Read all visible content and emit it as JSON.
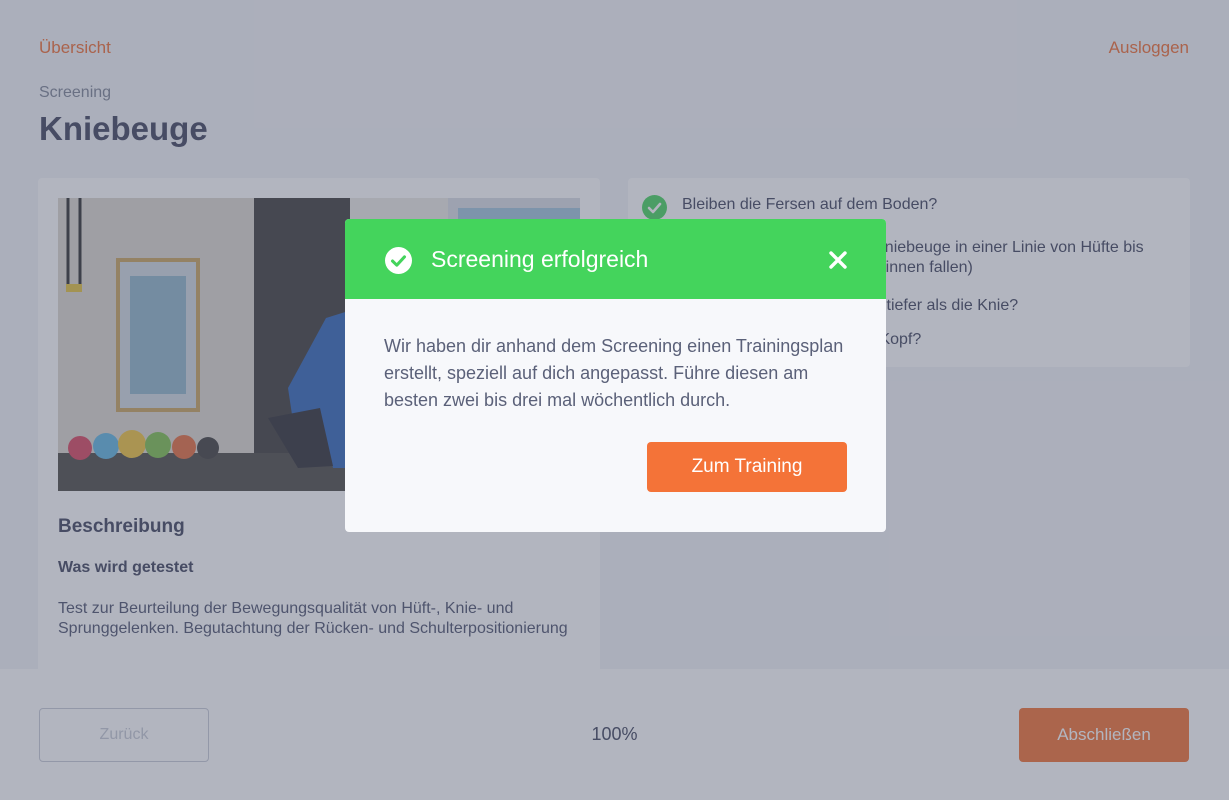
{
  "nav": {
    "overview_label": "Übersicht",
    "logout_label": "Ausloggen"
  },
  "header": {
    "breadcrumb": "Screening",
    "title": "Kniebeuge"
  },
  "description": {
    "heading": "Beschreibung",
    "subheading": "Was wird getestet",
    "text": "Test zur Beurteilung der Bewegungsqualität von Hüft-, Knie- und Sprunggelenken. Begutachtung der Rücken- und Schulterpositionierung"
  },
  "checklist": [
    {
      "text": "Bleiben die Fersen auf dem Boden?"
    },
    {
      "text": "Sind die Knie während der Kniebeuge in einer Linie von Hüfte bis Fuß? (Knie fallen nicht nach innen fallen)"
    },
    {
      "text": "Kommst du mit dem Becken tiefer als die Knie?"
    },
    {
      "text": "Bleiben die Arme über dem Kopf?"
    }
  ],
  "footer": {
    "back_label": "Zurück",
    "progress": "100%",
    "finish_label": "Abschließen"
  },
  "modal": {
    "title": "Screening erfolgreich",
    "body": "Wir haben dir anhand dem Screening einen Trainingsplan erstellt, speziell auf dich angepasst. Führe diesen am besten zwei bis drei mal wöchentlich durch.",
    "cta_label": "Zum Training"
  },
  "colors": {
    "accent": "#f47338",
    "success": "#44d45c",
    "text": "#3c4159"
  },
  "icons": {
    "check": "check-circle-icon",
    "close": "close-icon"
  }
}
